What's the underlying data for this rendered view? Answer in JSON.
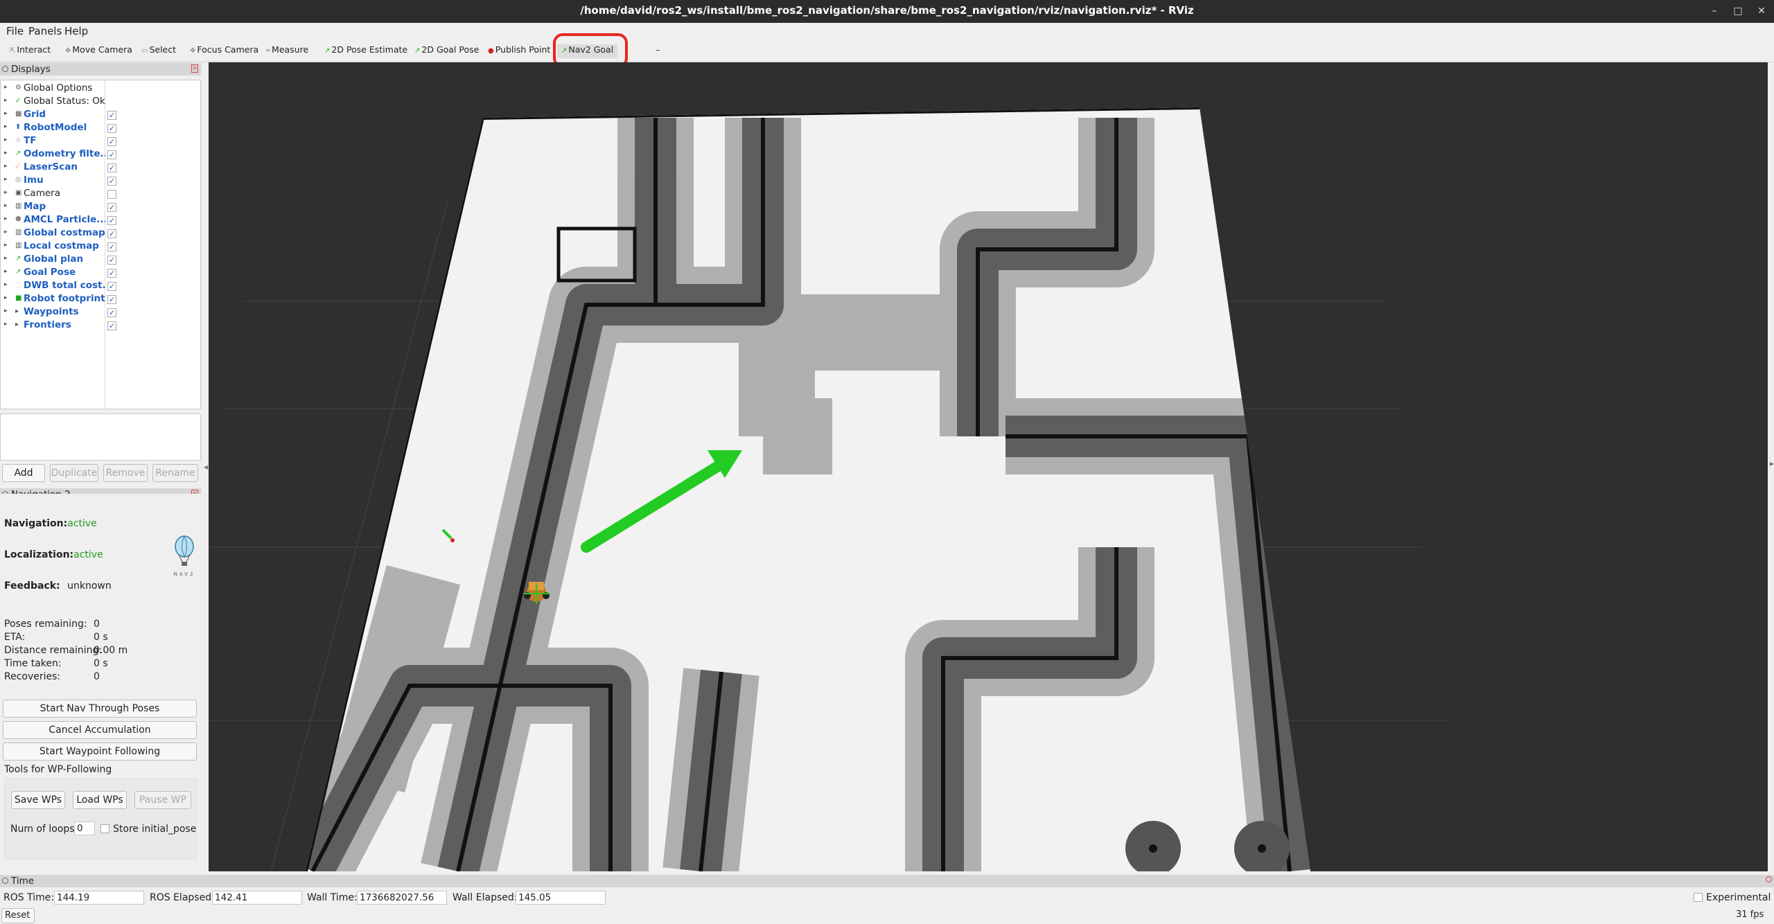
{
  "window": {
    "title": "/home/david/ros2_ws/install/bme_ros2_navigation/share/bme_ros2_navigation/rviz/navigation.rviz* - RViz"
  },
  "menu": [
    "File",
    "Panels",
    "Help"
  ],
  "toolbar": {
    "tools": [
      {
        "label": "Interact",
        "icon": "interact-icon"
      },
      {
        "label": "Move Camera",
        "icon": "move-camera-icon"
      },
      {
        "label": "Select",
        "icon": "select-icon"
      },
      {
        "label": "Focus Camera",
        "icon": "focus-camera-icon"
      },
      {
        "label": "Measure",
        "icon": "measure-icon"
      },
      {
        "label": "2D Pose Estimate",
        "icon": "pose-estimate-icon"
      },
      {
        "label": "2D Goal Pose",
        "icon": "goal-pose-icon"
      },
      {
        "label": "Publish Point",
        "icon": "publish-point-icon"
      },
      {
        "label": "Nav2 Goal",
        "icon": "nav2-goal-icon"
      }
    ],
    "more": "–"
  },
  "displays": {
    "title": "Displays",
    "items": [
      {
        "name": "Global Options",
        "bold": false,
        "checked": null
      },
      {
        "name": "Global Status: Ok",
        "bold": false,
        "checked": null
      },
      {
        "name": "Grid",
        "bold": true,
        "checked": true
      },
      {
        "name": "RobotModel",
        "bold": true,
        "checked": true
      },
      {
        "name": "TF",
        "bold": true,
        "checked": true
      },
      {
        "name": "Odometry filte...",
        "bold": true,
        "checked": true
      },
      {
        "name": "LaserScan",
        "bold": true,
        "checked": true
      },
      {
        "name": "Imu",
        "bold": true,
        "checked": true
      },
      {
        "name": "Camera",
        "bold": false,
        "checked": false
      },
      {
        "name": "Map",
        "bold": true,
        "checked": true
      },
      {
        "name": "AMCL Particle...",
        "bold": true,
        "checked": true
      },
      {
        "name": "Global costmap",
        "bold": true,
        "checked": true
      },
      {
        "name": "Local costmap",
        "bold": true,
        "checked": true
      },
      {
        "name": "Global plan",
        "bold": true,
        "checked": true
      },
      {
        "name": "Goal Pose",
        "bold": true,
        "checked": true
      },
      {
        "name": "DWB total cost...",
        "bold": true,
        "checked": true
      },
      {
        "name": "Robot footprint",
        "bold": true,
        "checked": true
      },
      {
        "name": "Waypoints",
        "bold": true,
        "checked": true
      },
      {
        "name": "Frontiers",
        "bold": true,
        "checked": true
      }
    ],
    "buttons": {
      "add": "Add",
      "duplicate": "Duplicate",
      "remove": "Remove",
      "rename": "Rename"
    }
  },
  "nav2": {
    "title": "Navigation 2",
    "navigation_label": "Navigation:",
    "navigation_value": "active",
    "localization_label": "Localization:",
    "localization_value": "active",
    "feedback_label": "Feedback:",
    "feedback_value": "unknown",
    "logo_text": "NAV2",
    "stats": [
      {
        "label": "Poses remaining:",
        "value": "0"
      },
      {
        "label": "ETA:",
        "value": "0 s"
      },
      {
        "label": "Distance remaining:",
        "value": "0.00 m"
      },
      {
        "label": "Time taken:",
        "value": "0 s"
      },
      {
        "label": "Recoveries:",
        "value": "0"
      }
    ],
    "buttons": {
      "start_nav_through_poses": "Start Nav Through Poses",
      "cancel_accumulation": "Cancel Accumulation",
      "start_waypoint_following": "Start Waypoint Following"
    },
    "wp_tools_label": "Tools for WP-Following",
    "save_wps": "Save WPs",
    "load_wps": "Load WPs",
    "pause_wp": "Pause WP",
    "num_loops_label": "Num of loops",
    "num_loops_value": "0",
    "store_initial_pose": "Store initial_pose"
  },
  "time": {
    "title": "Time",
    "ros_time_label": "ROS Time:",
    "ros_time": "144.19",
    "ros_elapsed_label": "ROS Elapsed:",
    "ros_elapsed": "142.41",
    "wall_time_label": "Wall Time:",
    "wall_time": "1736682027.56",
    "wall_elapsed_label": "Wall Elapsed:",
    "wall_elapsed": "145.05",
    "experimental": "Experimental",
    "fps": "31 fps",
    "reset": "Reset"
  },
  "colors": {
    "highlight": "#e8271e",
    "active_green": "#1fa01f",
    "display_blue": "#1e5fbf",
    "goal_arrow": "#22cc22"
  }
}
